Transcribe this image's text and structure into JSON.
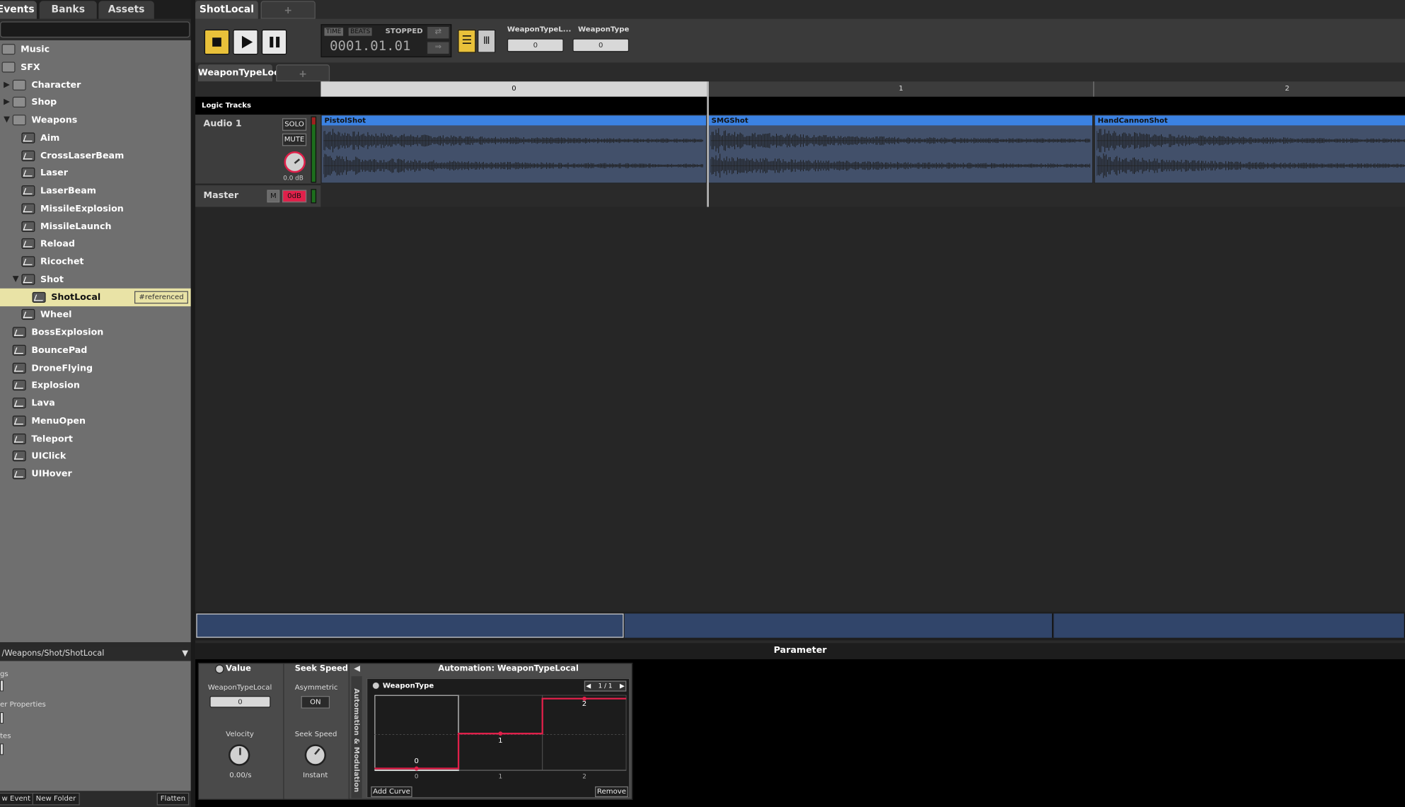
{
  "browser": {
    "tabs": [
      "Events",
      "Banks",
      "Assets"
    ],
    "tree": [
      {
        "label": "Music",
        "kind": "folder",
        "depth": 0
      },
      {
        "label": "SFX",
        "kind": "folder-open",
        "depth": 0
      },
      {
        "label": "Character",
        "kind": "folder",
        "depth": 1
      },
      {
        "label": "Shop",
        "kind": "folder",
        "depth": 1
      },
      {
        "label": "Weapons",
        "kind": "folder-open",
        "depth": 1
      },
      {
        "label": "Aim",
        "kind": "event",
        "depth": 2
      },
      {
        "label": "CrossLaserBeam",
        "kind": "event",
        "depth": 2
      },
      {
        "label": "Laser",
        "kind": "event",
        "depth": 2
      },
      {
        "label": "LaserBeam",
        "kind": "event",
        "depth": 2
      },
      {
        "label": "MissileExplosion",
        "kind": "event",
        "depth": 2
      },
      {
        "label": "MissileLaunch",
        "kind": "event",
        "depth": 2
      },
      {
        "label": "Reload",
        "kind": "event",
        "depth": 2
      },
      {
        "label": "Ricochet",
        "kind": "event",
        "depth": 2
      },
      {
        "label": "Shot",
        "kind": "event",
        "depth": 2
      },
      {
        "label": "ShotLocal",
        "kind": "event",
        "depth": 3
      },
      {
        "label": "Wheel",
        "kind": "event",
        "depth": 2
      },
      {
        "label": "BossExplosion",
        "kind": "event",
        "depth": 1
      },
      {
        "label": "BouncePad",
        "kind": "event",
        "depth": 1
      },
      {
        "label": "DroneFlying",
        "kind": "event",
        "depth": 1
      },
      {
        "label": "Explosion",
        "kind": "event",
        "depth": 1
      },
      {
        "label": "Lava",
        "kind": "event",
        "depth": 1
      },
      {
        "label": "MenuOpen",
        "kind": "event",
        "depth": 1
      },
      {
        "label": "Teleport",
        "kind": "event",
        "depth": 1
      },
      {
        "label": "UIClick",
        "kind": "event",
        "depth": 1
      },
      {
        "label": "UIHover",
        "kind": "event",
        "depth": 1
      }
    ],
    "selected_badge": "#referenced",
    "path": "/Weapons/Shot/ShotLocal",
    "props": [
      "gs",
      "er Properties",
      "tes"
    ],
    "buttons": {
      "new_event": "w Event",
      "new_folder": "New Folder",
      "flatten": "Flatten"
    }
  },
  "document": {
    "tab": "ShotLocal",
    "add_tab": "+",
    "transport": {
      "time_mode": "TIME",
      "beats_mode": "BEATS",
      "state": "STOPPED",
      "position": "0001.01.01"
    },
    "params": [
      {
        "name": "WeaponTypeL...",
        "value": "0"
      },
      {
        "name": "WeaponType",
        "value": "0"
      }
    ],
    "subtab": "WeaponTypeLocal",
    "ruler": [
      "0",
      "1",
      "2"
    ],
    "logic_tracks": "Logic Tracks",
    "track": {
      "name": "Audio 1",
      "solo": "SOLO",
      "mute": "MUTE",
      "volume": "0.0 dB"
    },
    "master": {
      "name": "Master",
      "m": "M",
      "vol": "0dB"
    },
    "instruments": [
      "PistolShot",
      "SMGShot",
      "HandCannonShot"
    ]
  },
  "parameter": {
    "title": "Parameter",
    "value_header": "Value",
    "seek_header": "Seek Speed",
    "automation_header": "Automation: WeaponTypeLocal",
    "param_name": "WeaponTypeLocal",
    "param_value": "0",
    "asymmetric_label": "Asymmetric",
    "asymmetric_value": "ON",
    "velocity_label": "Velocity",
    "velocity_value": "0.00/s",
    "seek_label": "Seek Speed",
    "seek_value": "Instant",
    "side_label": "Automation & Modulation",
    "curve_name": "WeaponType",
    "curve_pager": "1 / 1",
    "curve_points": [
      {
        "x": 0,
        "y": 0,
        "label": "0"
      },
      {
        "x": 1,
        "y": 1,
        "label": "1"
      },
      {
        "x": 2,
        "y": 2,
        "label": "2"
      }
    ],
    "x_ticks": [
      "0",
      "1",
      "2"
    ],
    "add_curve": "Add Curve",
    "remove": "Remove"
  },
  "colors": {
    "accent_yellow": "#e9c13a",
    "selection": "#e9e3a6",
    "instrument_header": "#3b82e3",
    "curve": "#e0204a"
  }
}
